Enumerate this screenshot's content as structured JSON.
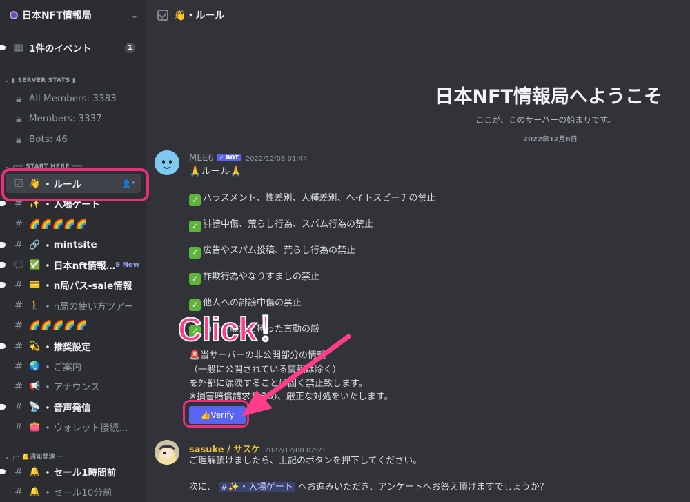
{
  "server": {
    "name": "日本NFT情報局"
  },
  "sidebar": {
    "events": {
      "label": "1件のイベント",
      "count": "1"
    },
    "categories": {
      "server_stats": "SERVER STATS",
      "start_here": "┌── START HERE ──┐",
      "notify": "┌─ 🔔通知関連 ─┐"
    },
    "stats": [
      "All Members: 3383",
      "Members: 3337",
      "Bots: 46"
    ],
    "channels": [
      {
        "emoji": "👋",
        "name": "ルール"
      },
      {
        "emoji": "✨",
        "name": "入場ゲート"
      },
      {
        "emoji": "",
        "name": "🌈🌈🌈🌈🌈"
      },
      {
        "emoji": "🔗",
        "name": "mintsite"
      },
      {
        "emoji": "✅",
        "name": "日本nft情報…",
        "badge": "9 New"
      },
      {
        "emoji": "💳",
        "name": "n局パス-sale情報"
      },
      {
        "emoji": "🚶",
        "name": "n局の使い方ツアー"
      },
      {
        "emoji": "",
        "name": "🌈🌈🌈🌈🌈"
      },
      {
        "emoji": "💫",
        "name": "推奨設定"
      },
      {
        "emoji": "🌏",
        "name": "ご案内"
      },
      {
        "emoji": "📢",
        "name": "アナウンス"
      },
      {
        "emoji": "📡",
        "name": "音声発信"
      },
      {
        "emoji": "👛",
        "name": "ウォレット接続…"
      },
      {
        "emoji": "🔔",
        "name": "セール1時間前"
      },
      {
        "emoji": "🔔",
        "name": "セール10分前"
      }
    ]
  },
  "channel": {
    "title": "👋・ルール"
  },
  "welcome": {
    "title": "日本NFT情報局へようこそ",
    "subtitle": "ここが、このサーバーの始まりです。",
    "date": "2022年12月8日"
  },
  "messages": {
    "mee6": {
      "author": "MEE6",
      "bot_tag": "✓ BOT",
      "time": "2022/12/08 01:44",
      "heading": "🙏ルール🙏",
      "rules": [
        "ハラスメント、性差別、人種差別、ヘイトスピーチの禁止",
        "誹謗中傷、荒らし行為、スパム行為の禁止",
        "広告やスパム投稿、荒らし行為の禁止",
        "詐欺行為やなりすましの禁止",
        "他人への誹謗中傷の禁止",
        "節度と敬意を持った言動の厳"
      ],
      "notice": [
        "🚨当サーバーの非公開部分の情報",
        "（一般に公開されている情報は除く）",
        "を外部に漏洩することは固く禁止致します。",
        "※損害賠償請求も含め、厳正な対処をいたします。"
      ],
      "button": "👍Verify"
    },
    "sasuke": {
      "author": "sasuke / サスケ",
      "time": "2022/12/08 02:21",
      "line1": "ご理解頂けましたら、上記のボタンを押下してください。",
      "line2_pre": "次に、",
      "mention": "#✨・入場ゲート",
      "line2_post": "へお進みいただき、アンケートへお答え頂けますでしょうか？"
    }
  },
  "annotation": {
    "click": "Click！"
  },
  "colors": {
    "accent": "#5865f2",
    "highlight": "#e8307a"
  }
}
